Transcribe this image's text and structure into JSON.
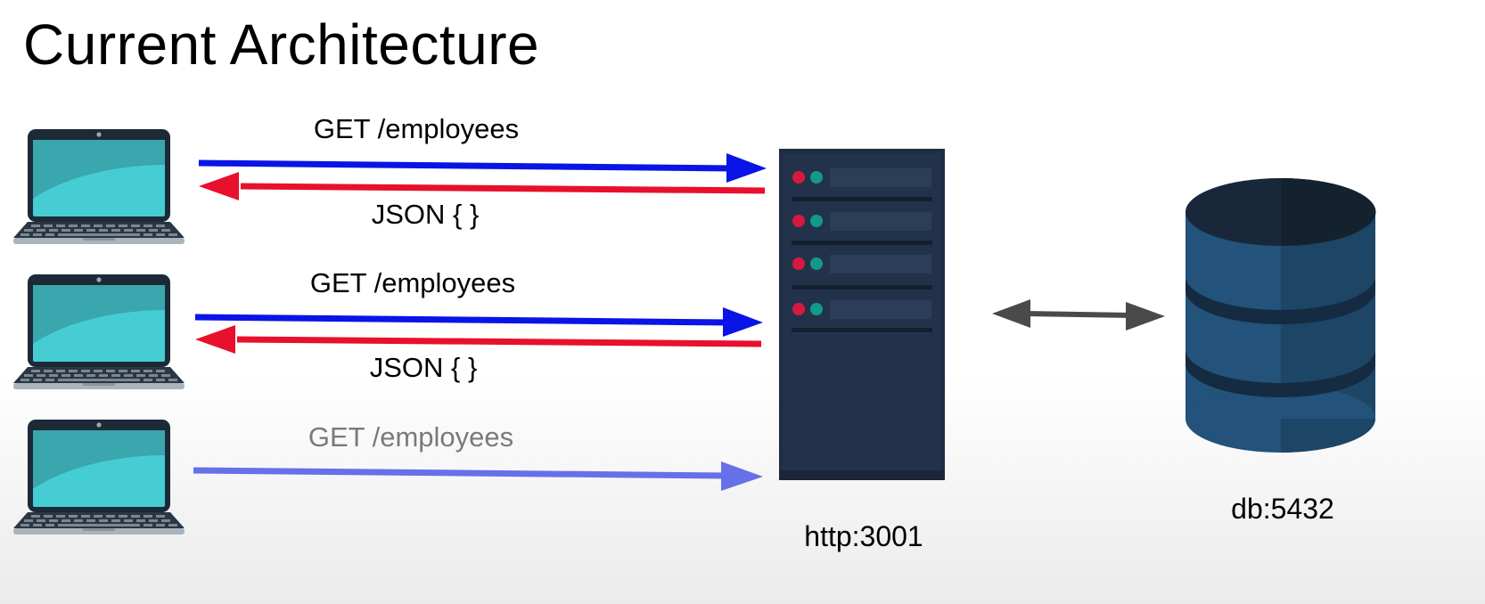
{
  "title": "Current Architecture",
  "requests": [
    {
      "request_label": "GET /employees",
      "response_label": "JSON { }",
      "active": true
    },
    {
      "request_label": "GET /employees",
      "response_label": "JSON { }",
      "active": true
    },
    {
      "request_label": "GET /employees",
      "response_label": "",
      "active": false
    }
  ],
  "server": {
    "label": "http:3001",
    "icon": "server-rack-icon"
  },
  "database": {
    "label": "db:5432",
    "icon": "database-cylinder-icon"
  },
  "colors": {
    "request_arrow": "#0a14e6",
    "response_arrow": "#e8102c",
    "pending_arrow": "#6670e8",
    "db_link_arrow": "#4a4a4a",
    "server_body": "#1f2d42",
    "db_body": "#23527a",
    "laptop_screen": "#46cdd3"
  }
}
